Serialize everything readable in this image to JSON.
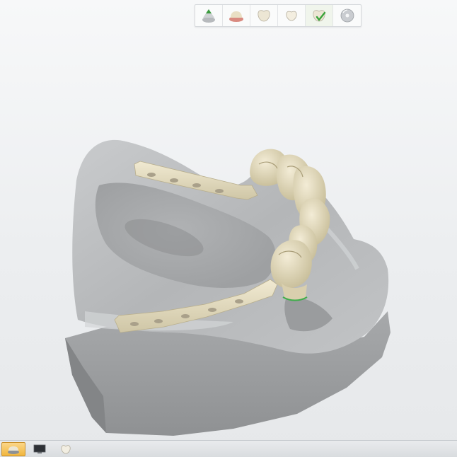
{
  "colors": {
    "background": "#eceef0",
    "model_gray": "#b9bbbd",
    "framework_beige": "#e4dcc1",
    "active_taskbar": "#f1b63e",
    "active_step_check": "#3aa33a"
  },
  "workflow": {
    "steps": [
      {
        "icon": "scan-upload-icon",
        "state": "default"
      },
      {
        "icon": "gingiva-icon",
        "state": "default"
      },
      {
        "icon": "crown-icon",
        "state": "default"
      },
      {
        "icon": "tooth-anatomy-icon",
        "state": "default"
      },
      {
        "icon": "tooth-check-icon",
        "state": "active"
      },
      {
        "icon": "disc-icon",
        "state": "default"
      }
    ]
  },
  "taskbar": {
    "buttons": [
      {
        "icon": "dental-case-icon",
        "state": "active"
      },
      {
        "icon": "monitor-icon",
        "state": "normal"
      },
      {
        "icon": "crown-window-icon",
        "state": "normal"
      }
    ]
  }
}
